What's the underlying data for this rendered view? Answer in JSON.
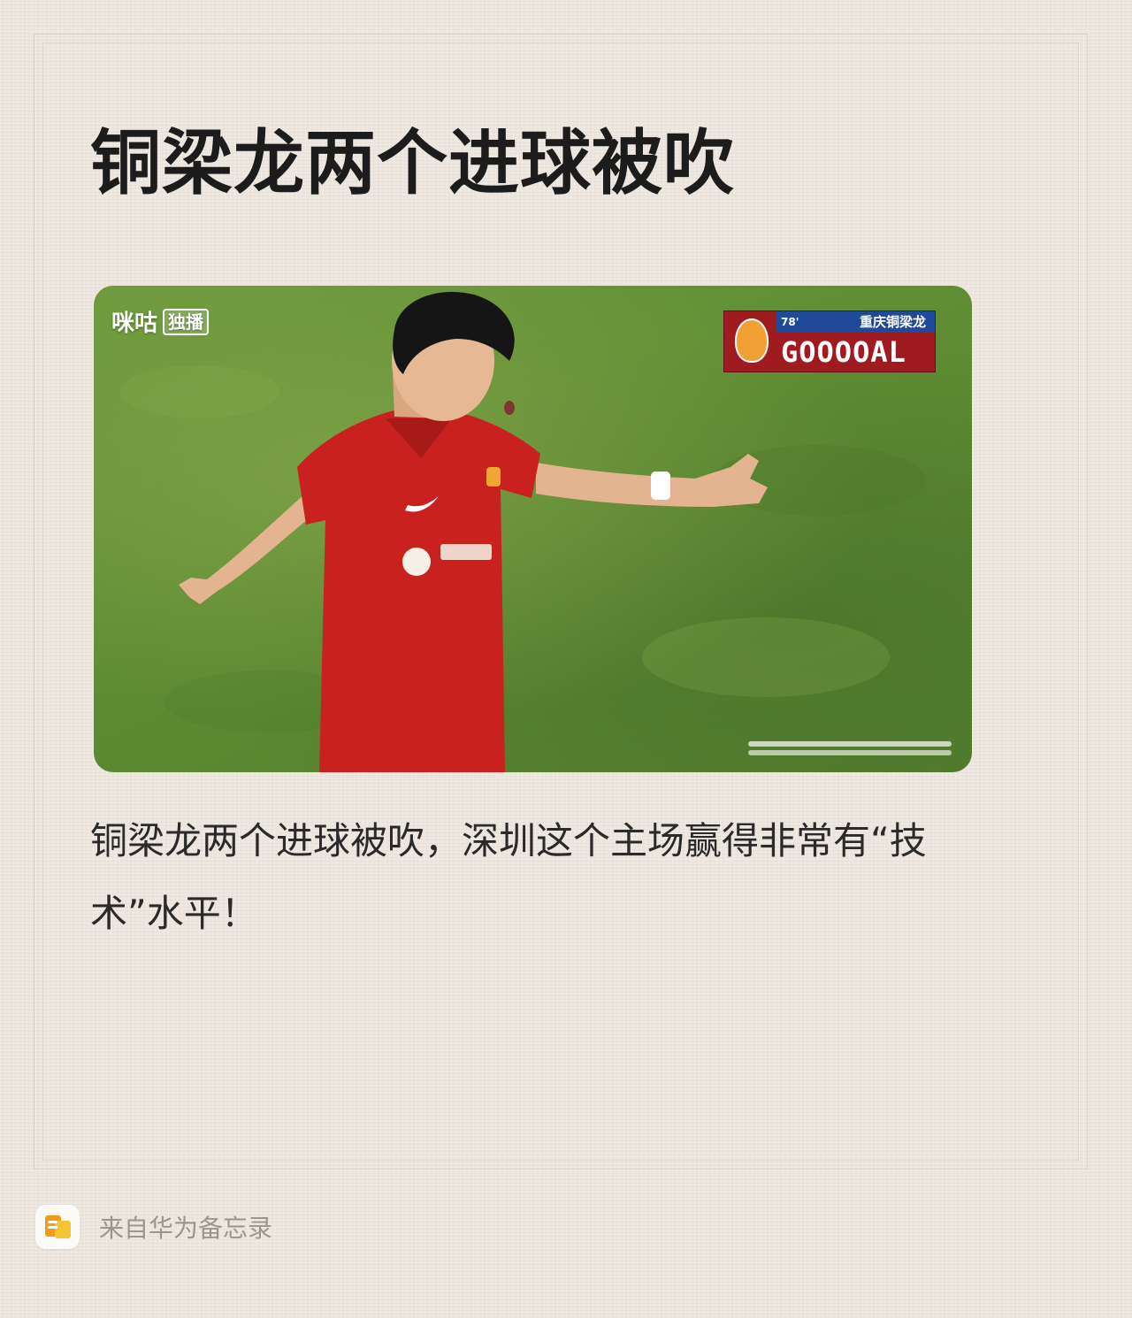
{
  "note": {
    "title": "铜梁龙两个进球被吹",
    "body": "铜梁龙两个进球被吹，深圳这个主场赢得非常有“技术”水平！"
  },
  "video": {
    "broadcaster_logo": "咪咕",
    "broadcaster_badge": "独播",
    "overlay": {
      "minute": "78'",
      "team": "重庆铜梁龙",
      "text": "GOOOOAL"
    }
  },
  "footer": {
    "source_label": "来自华为备忘录",
    "icon": "memo-app-icon"
  },
  "colors": {
    "background": "#ece6de",
    "title": "#1c1c1c",
    "body": "#2a2a2a",
    "footer_text": "#9b958e",
    "overlay_red": "#a01b20",
    "overlay_blue": "#20499a"
  }
}
